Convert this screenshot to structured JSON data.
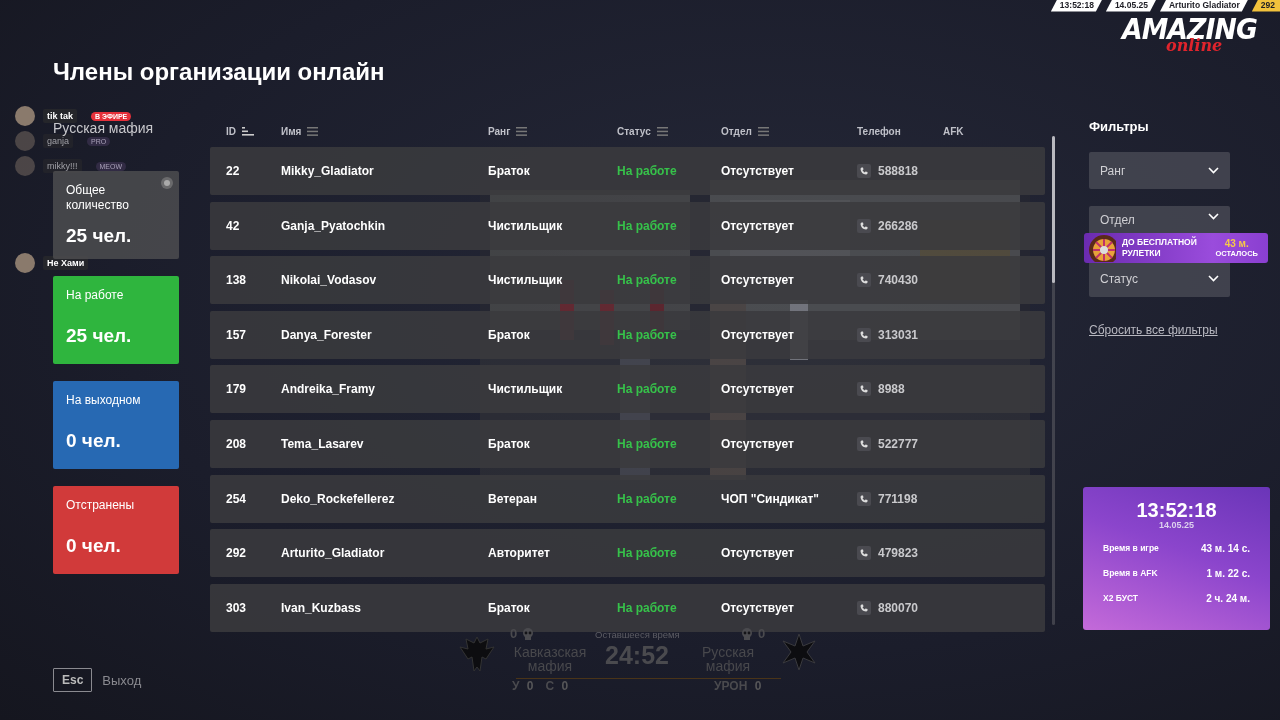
{
  "hud": {
    "time": "13:52:18",
    "date": "14.05.25",
    "player": "Arturito Gladiator",
    "level": "292"
  },
  "logo": {
    "title": "AMAZING",
    "subtitle": "online"
  },
  "title": "Члены организации онлайн",
  "organization": "Русская мафия",
  "stream_chat": {
    "messages": [
      {
        "user": "tik tak",
        "badge": "В ЭФИРЕ",
        "faded": false
      },
      {
        "user": "ganja",
        "badge": "PRO",
        "faded": true
      },
      {
        "user": "mikky!!!",
        "badge": "MEOW",
        "faded": true
      },
      {
        "user": "Не Хами",
        "faded": false
      }
    ]
  },
  "stats": [
    {
      "kind": "total",
      "label": "Общее количество",
      "value": "25 чел."
    },
    {
      "kind": "working",
      "label": "На работе",
      "value": "25 чел."
    },
    {
      "kind": "off",
      "label": "На выходном",
      "value": "0 чел."
    },
    {
      "kind": "suspended",
      "label": "Отстранены",
      "value": "0 чел."
    }
  ],
  "table": {
    "columns": [
      {
        "label": "ID"
      },
      {
        "label": "Имя"
      },
      {
        "label": "Ранг"
      },
      {
        "label": "Статус"
      },
      {
        "label": "Отдел"
      },
      {
        "label": "Телефон"
      },
      {
        "label": "AFK"
      }
    ],
    "rows": [
      {
        "id": "22",
        "name": "Mikky_Gladiator",
        "rank": "Браток",
        "status": "На работе",
        "department": "Отсутствует",
        "phone": "588818"
      },
      {
        "id": "42",
        "name": "Ganja_Pyatochkin",
        "rank": "Чистильщик",
        "status": "На работе",
        "department": "Отсутствует",
        "phone": "266286"
      },
      {
        "id": "138",
        "name": "Nikolai_Vodasov",
        "rank": "Чистильщик",
        "status": "На работе",
        "department": "Отсутствует",
        "phone": "740430"
      },
      {
        "id": "157",
        "name": "Danya_Forester",
        "rank": "Браток",
        "status": "На работе",
        "department": "Отсутствует",
        "phone": "313031"
      },
      {
        "id": "179",
        "name": "Andreika_Framy",
        "rank": "Чистильщик",
        "status": "На работе",
        "department": "Отсутствует",
        "phone": "8988"
      },
      {
        "id": "208",
        "name": "Tema_Lasarev",
        "rank": "Браток",
        "status": "На работе",
        "department": "Отсутствует",
        "phone": "522777"
      },
      {
        "id": "254",
        "name": "Deko_Rockefellerez",
        "rank": "Ветеран",
        "status": "На работе",
        "department": "ЧОП \"Синдикат\"",
        "phone": "771198"
      },
      {
        "id": "292",
        "name": "Arturito_Gladiator",
        "rank": "Авторитет",
        "status": "На работе",
        "department": "Отсутствует",
        "phone": "479823"
      },
      {
        "id": "303",
        "name": "Ivan_Kuzbass",
        "rank": "Браток",
        "status": "На работе",
        "department": "Отсутствует",
        "phone": "880070"
      }
    ]
  },
  "filters": {
    "title": "Фильтры",
    "selects": [
      "Ранг",
      "Отдел",
      "Статус"
    ],
    "reset": "Сбросить все фильтры"
  },
  "promo": {
    "text": "ДО БЕСПЛАТНОЙ РУЛЕТКИ",
    "time": "43 м.",
    "caption": "ОСТАЛОСЬ"
  },
  "clock": {
    "time": "13:52:18",
    "date": "14.05.25",
    "stats": [
      {
        "label": "Время в игре",
        "value": "43 м. 14 с."
      },
      {
        "label": "Время в AFK",
        "value": "1 м. 22 с."
      },
      {
        "label": "X2 БУСТ",
        "value": "2 ч. 24 м."
      }
    ]
  },
  "scoreboard": {
    "caption": "Оставшееся время",
    "timer": "24:52",
    "left": {
      "name": "Кавказская мафия",
      "kills": "0",
      "stats": [
        {
          "label": "У",
          "value": "0"
        },
        {
          "label": "С",
          "value": "0"
        }
      ]
    },
    "right": {
      "name": "Русская мафия",
      "kills": "0",
      "stats": [
        {
          "label": "УРОН",
          "value": "0"
        }
      ]
    }
  },
  "exit": {
    "key": "Esc",
    "label": "Выход"
  }
}
